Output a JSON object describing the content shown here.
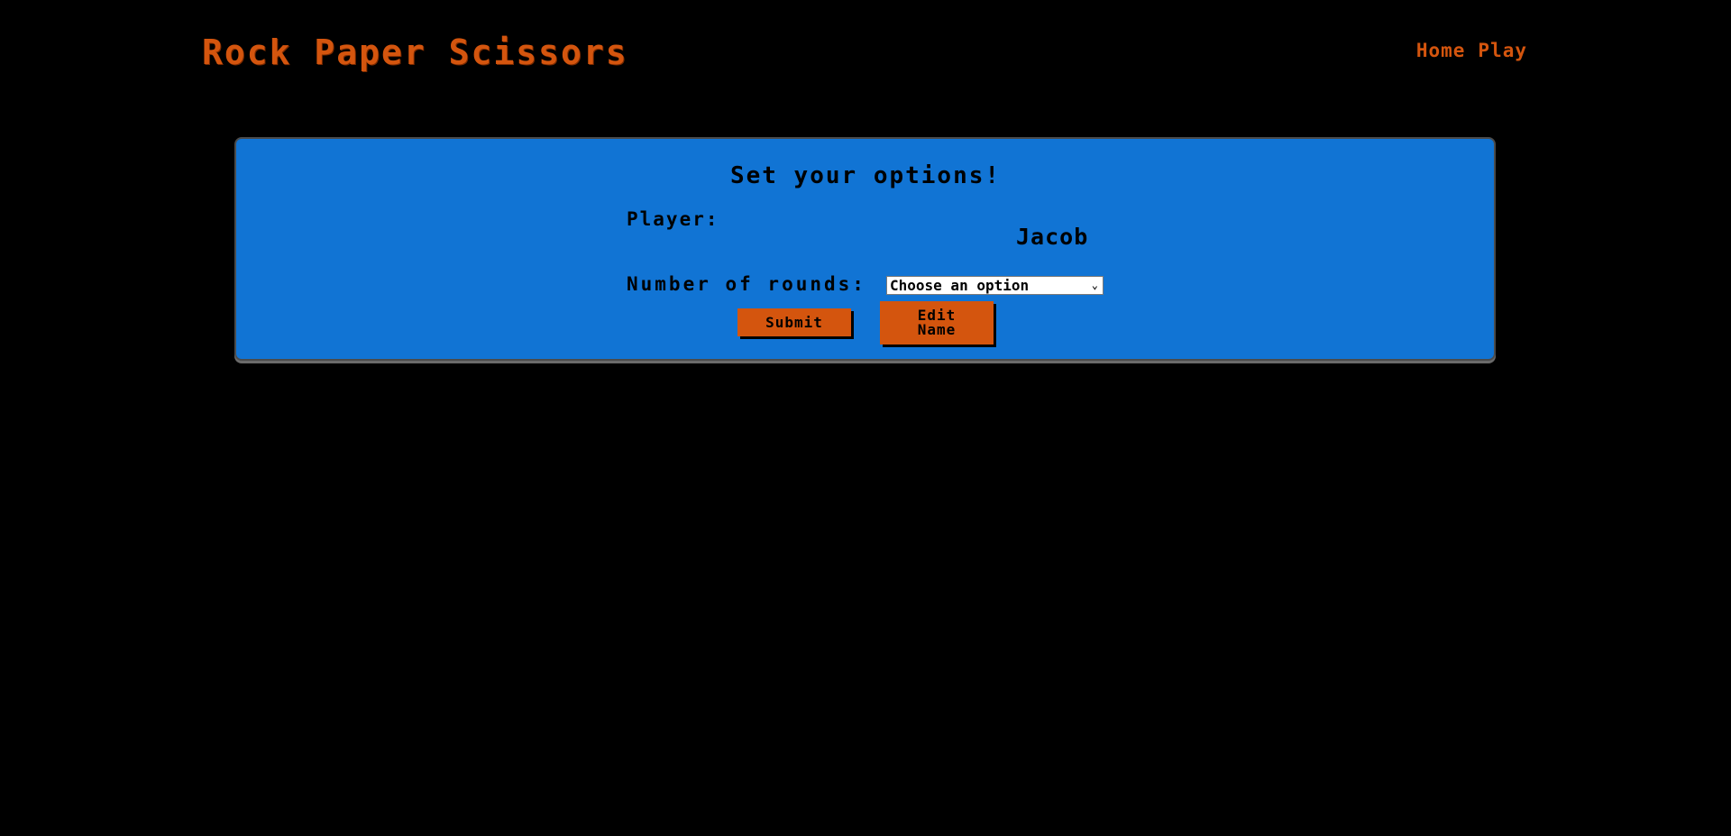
{
  "header": {
    "title": "Rock Paper Scissors",
    "nav": [
      {
        "label": "Home"
      },
      {
        "label": "Play"
      }
    ]
  },
  "options": {
    "heading": "Set your options!",
    "player_label": "Player:",
    "player_name": "Jacob",
    "rounds_label": "Number of rounds:",
    "rounds_select_value": "Choose an option",
    "submit_label": "Submit",
    "edit_label_line1": "Edit",
    "edit_label_line2": "Name"
  },
  "colors": {
    "background": "#000000",
    "accent_orange": "#d4550e",
    "card_blue": "#1174d4"
  }
}
